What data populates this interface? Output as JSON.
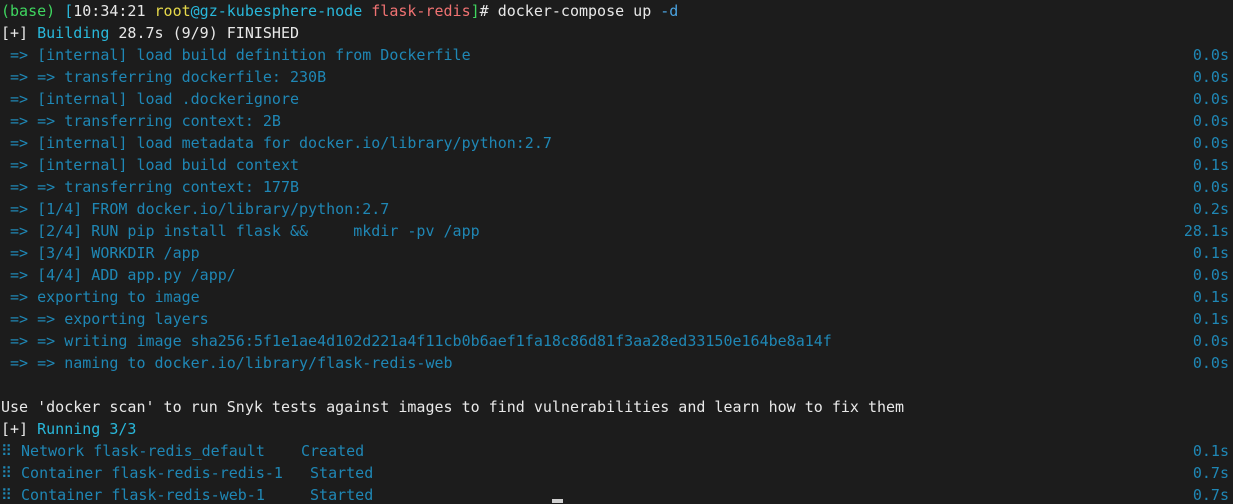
{
  "terminal": {
    "background_color": "#1c1c1c",
    "colors": {
      "white": "#e8e8e8",
      "green": "#3fd65f",
      "cyan": "#29b8db",
      "yellow": "#e6d94a",
      "blue": "#4aa3e0",
      "red": "#f07272",
      "dim_cyan": "#1f87b5"
    },
    "prompt": {
      "conda_env": "(base)",
      "open_bracket": "[",
      "time": "10:34:21",
      "user": "root",
      "at_host": "@gz-kubesphere-node",
      "cwd": "flask-redis",
      "close_bracket": "]",
      "hash": "#",
      "command": "docker-compose up",
      "flag": "-d"
    },
    "build_header": {
      "marker": "[+]",
      "label": "Building",
      "status": "28.7s (9/9) FINISHED"
    },
    "build_steps": [
      {
        "text": " => [internal] load build definition from Dockerfile",
        "time": "0.0s"
      },
      {
        "text": " => => transferring dockerfile: 230B",
        "time": "0.0s"
      },
      {
        "text": " => [internal] load .dockerignore",
        "time": "0.0s"
      },
      {
        "text": " => => transferring context: 2B",
        "time": "0.0s"
      },
      {
        "text": " => [internal] load metadata for docker.io/library/python:2.7",
        "time": "0.0s"
      },
      {
        "text": " => [internal] load build context",
        "time": "0.1s"
      },
      {
        "text": " => => transferring context: 177B",
        "time": "0.0s"
      },
      {
        "text": " => [1/4] FROM docker.io/library/python:2.7",
        "time": "0.2s"
      },
      {
        "text": " => [2/4] RUN pip install flask &&     mkdir -pv /app",
        "time": "28.1s"
      },
      {
        "text": " => [3/4] WORKDIR /app",
        "time": "0.1s"
      },
      {
        "text": " => [4/4] ADD app.py /app/",
        "time": "0.0s"
      },
      {
        "text": " => exporting to image",
        "time": "0.1s"
      },
      {
        "text": " => => exporting layers",
        "time": "0.1s"
      },
      {
        "text": " => => writing image sha256:5f1e1ae4d102d221a4f11cb0b6aef1fa18c86d81f3aa28ed33150e164be8a14f",
        "time": "0.0s"
      },
      {
        "text": " => => naming to docker.io/library/flask-redis-web",
        "time": "0.0s"
      }
    ],
    "scan_notice": "Use 'docker scan' to run Snyk tests against images to find vulnerabilities and learn how to fix them",
    "run_header": {
      "marker": "[+]",
      "label": "Running 3/3"
    },
    "run_items": [
      {
        "glyph": "⠿",
        "text": " Network flask-redis_default    Created",
        "time": "0.1s"
      },
      {
        "glyph": "⠿",
        "text": " Container flask-redis-redis-1   Started",
        "time": "0.7s"
      },
      {
        "glyph": "⠿",
        "text": " Container flask-redis-web-1     Started",
        "time": "0.7s"
      }
    ]
  }
}
